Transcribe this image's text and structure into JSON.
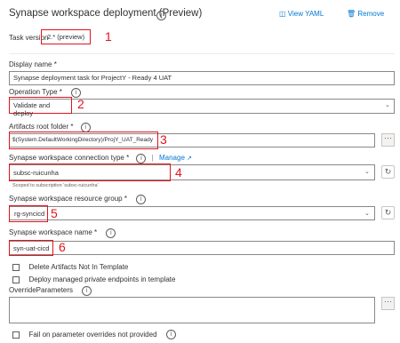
{
  "header": {
    "title": "Synapse workspace deployment (Preview)",
    "view_yaml": "View YAML",
    "remove": "Remove"
  },
  "task_version": {
    "label": "Task version",
    "value": "2.* (preview)"
  },
  "display_name": {
    "label": "Display name *",
    "value": "Synapse deployment task for ProjectY - Ready 4 UAT"
  },
  "operation_type": {
    "label": "Operation Type *",
    "value": "Validate and deploy"
  },
  "artifacts_root": {
    "label": "Artifacts root folder *",
    "value": "$(System.DefaultWorkingDirectory)/ProjY_UAT_Ready"
  },
  "connection_type": {
    "label": "Synapse workspace connection type *",
    "manage": "Manage",
    "value": "subsc-ruicunha",
    "hint": "Scoped to subscription 'subsc-ruicunha'"
  },
  "resource_group": {
    "label": "Synapse workspace resource group *",
    "value": "rg-syncicd"
  },
  "workspace_name": {
    "label": "Synapse workspace name *",
    "value": "syn-uat-cicd"
  },
  "checkboxes": [
    "Delete Artifacts Not In Template",
    "Deploy managed private endpoints in template"
  ],
  "override": {
    "label": "OverrideParameters"
  },
  "fail_checkbox": "Fail on parameter overrides not provided",
  "annotations": [
    "1",
    "2",
    "3",
    "4",
    "5",
    "6"
  ],
  "colors": {
    "accent": "#0078d4",
    "highlight": "#e0141e"
  },
  "icons": {
    "info": "info-icon",
    "yaml": "view-yaml-icon",
    "remove": "trash-icon",
    "refresh": "refresh-icon",
    "more": "more-icon",
    "dropdown": "chevron-down-icon",
    "external": "external-link-icon"
  }
}
